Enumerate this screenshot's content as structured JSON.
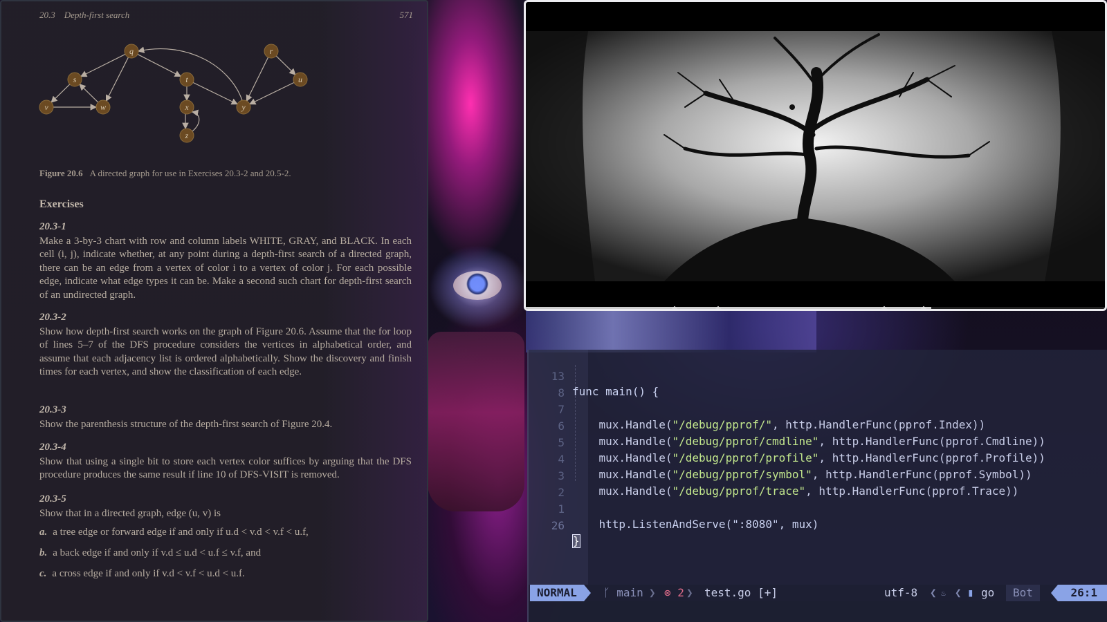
{
  "pdf": {
    "section": "20.3    Depth-first search",
    "page_number": "571",
    "graph": {
      "vertices": [
        "q",
        "r",
        "s",
        "t",
        "u",
        "v",
        "w",
        "x",
        "y",
        "z"
      ]
    },
    "figure_label": "Figure 20.6",
    "figure_caption": "A directed graph for use in Exercises 20.3-2 and 20.5-2.",
    "exercises_heading": "Exercises",
    "exercises": [
      {
        "num": "20.3-1",
        "text": "Make a 3-by-3 chart with row and column labels WHITE, GRAY, and BLACK. In each cell (i, j), indicate whether, at any point during a depth-first search of a directed graph, there can be an edge from a vertex of color i to a vertex of color j. For each possible edge, indicate what edge types it can be. Make a second such chart for depth-first search of an undirected graph."
      },
      {
        "num": "20.3-2",
        "text": "Show how depth-first search works on the graph of Figure 20.6. Assume that the for loop of lines 5–7 of the DFS procedure considers the vertices in alphabetical order, and assume that each adjacency list is ordered alphabetically. Show the discovery and finish times for each vertex, and show the classification of each edge."
      },
      {
        "num": "20.3-3",
        "text": "Show the parenthesis structure of the depth-first search of Figure 20.4."
      },
      {
        "num": "20.3-4",
        "text": "Show that using a single bit to store each vertex color suffices by arguing that the DFS procedure produces the same result if line 10 of DFS-VISIT is removed."
      },
      {
        "num": "20.3-5",
        "text": "Show that in a directed graph, edge (u, v) is"
      }
    ],
    "items": [
      {
        "label": "a.",
        "text": "a tree edge or forward edge if and only if u.d < v.d < v.f < u.f,"
      },
      {
        "label": "b.",
        "text": "a back edge if and only if v.d ≤ u.d < u.f ≤ v.f, and"
      },
      {
        "label": "c.",
        "text": "a cross edge if and only if v.d < v.f < u.d < u.f."
      }
    ]
  },
  "video": {
    "progress": 0.7
  },
  "editor": {
    "lines": [
      {
        "num": "13",
        "text": "func main() {"
      },
      {
        "num": "8",
        "text": ""
      },
      {
        "num": "7",
        "pre": "    mux.Handle(",
        "str": "\"/debug/pprof/\"",
        "post": ", http.HandlerFunc(pprof.Index))"
      },
      {
        "num": "6",
        "pre": "    mux.Handle(",
        "str": "\"/debug/pprof/cmdline\"",
        "post": ", http.HandlerFunc(pprof.Cmdline))"
      },
      {
        "num": "5",
        "pre": "    mux.Handle(",
        "str": "\"/debug/pprof/profile\"",
        "post": ", http.HandlerFunc(pprof.Profile))"
      },
      {
        "num": "4",
        "pre": "    mux.Handle(",
        "str": "\"/debug/pprof/symbol\"",
        "post": ", http.HandlerFunc(pprof.Symbol))"
      },
      {
        "num": "3",
        "pre": "    mux.Handle(",
        "str": "\"/debug/pprof/trace\"",
        "post": ", http.HandlerFunc(pprof.Trace))"
      },
      {
        "num": "2",
        "text": ""
      },
      {
        "num": "1",
        "text": "    http.ListenAndServe(\":8080\", mux)"
      },
      {
        "num": "26",
        "cursor": "}"
      }
    ],
    "status": {
      "mode": "NORMAL",
      "branch_icon": "git-branch-icon",
      "branch": "main",
      "error_icon": "error-circle-icon",
      "errors": "2",
      "file": "test.go [+]",
      "encoding": "utf-8",
      "format_icon": "flame-icon",
      "filetype_icon": "go-file-icon",
      "filetype": "go",
      "scroll": "Bot",
      "position": "26:1"
    },
    "colors": {
      "mode_bg": "#8aa3e6",
      "string": "#c3e88d",
      "error": "#e06c8a"
    }
  }
}
